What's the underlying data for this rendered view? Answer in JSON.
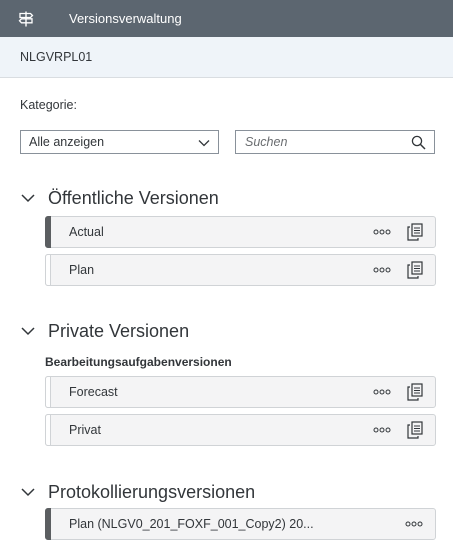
{
  "header": {
    "title": "Versionsverwaltung",
    "icon": "signpost-icon"
  },
  "subheader": {
    "model": "NLGVRPL01"
  },
  "filter": {
    "category_label": "Kategorie:",
    "category_value": "Alle anzeigen",
    "search_placeholder": "Suchen"
  },
  "sections": [
    {
      "title": "Öffentliche Versionen",
      "items": [
        {
          "name": "Actual",
          "active": true
        },
        {
          "name": "Plan",
          "active": false
        }
      ]
    },
    {
      "title": "Private Versionen",
      "subgroup": "Bearbeitungsaufgabenversionen",
      "items": [
        {
          "name": "Forecast",
          "active": false
        },
        {
          "name": "Privat",
          "active": false
        }
      ]
    },
    {
      "title": "Protokollierungsversionen",
      "items": [
        {
          "name": "Plan (NLGV0_201_FOXF_001_Copy2) 20...",
          "active": true
        }
      ]
    }
  ],
  "colors": {
    "titlebar": "#5c6670",
    "subheader": "#eff4f9",
    "item_bg": "#f4f4f5",
    "active_marker": "#5b5e61",
    "icon": "#0a6ed1"
  }
}
